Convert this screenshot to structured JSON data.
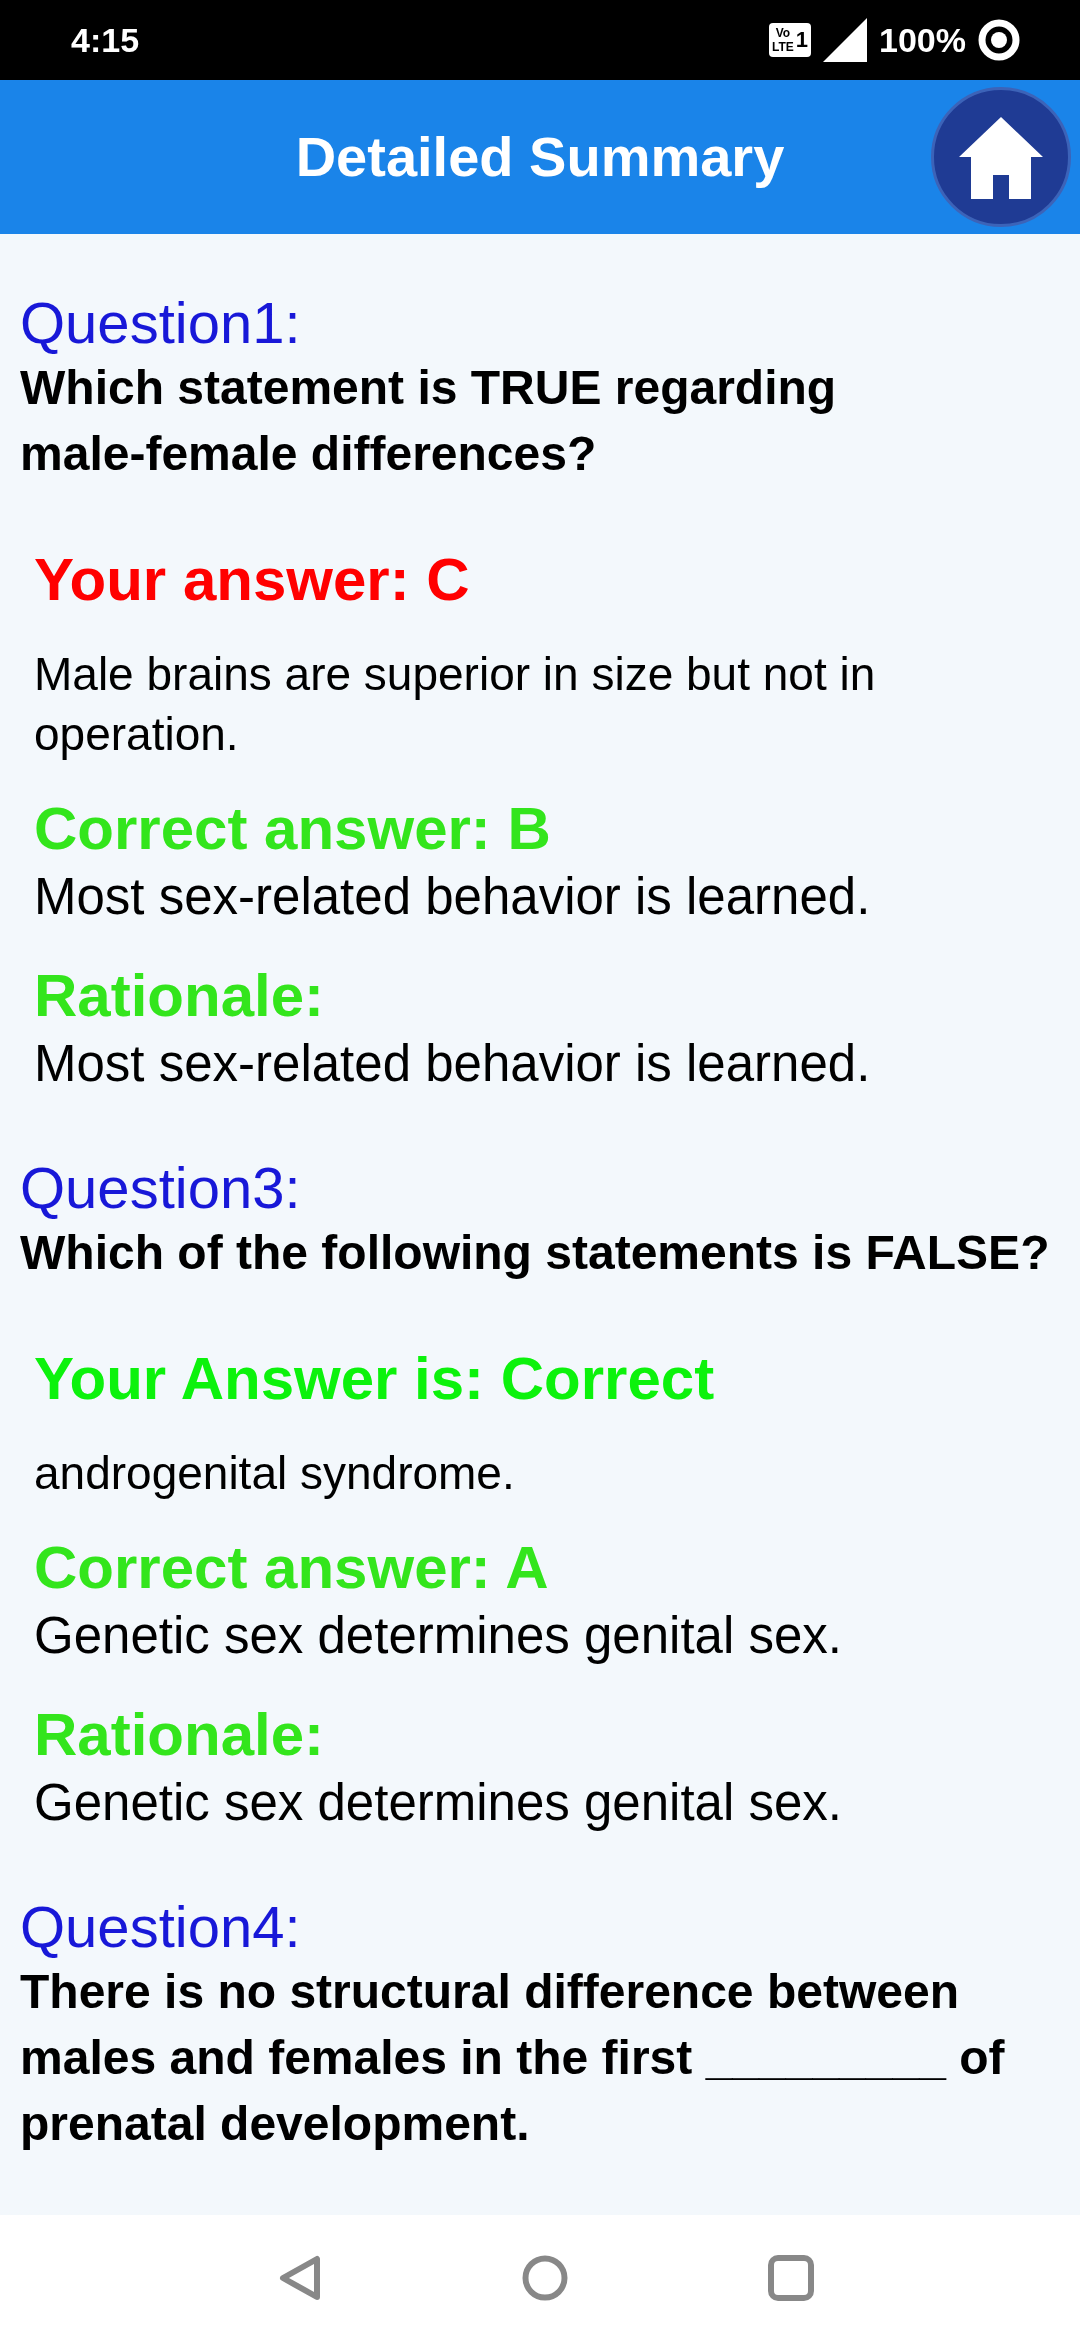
{
  "status_bar": {
    "time": "4:15",
    "volte_top": "Vo",
    "volte_bottom": "LTE",
    "sim": "1",
    "battery": "100%"
  },
  "header": {
    "title": "Detailed Summary"
  },
  "questions": [
    {
      "label": "Question1:",
      "text": "Which statement is TRUE regarding male-female differences?",
      "result": {
        "is_correct": false,
        "text": "Your answer: C"
      },
      "answer_text": "Male brains are superior in size but not in operation.",
      "correct_label": "Correct answer: B",
      "correct_text": "Most sex-related behavior is learned.",
      "rationale_label": "Rationale:",
      "rationale_text": "Most sex-related behavior is learned."
    },
    {
      "label": "Question3:",
      "text": "Which of the following statements is FALSE?",
      "result": {
        "is_correct": true,
        "text": "Your Answer is: Correct"
      },
      "answer_text": "androgenital syndrome.",
      "correct_label": "Correct answer: A",
      "correct_text": "Genetic sex determines genital sex.",
      "rationale_label": "Rationale:",
      "rationale_text": "Genetic sex determines genital sex."
    },
    {
      "label": "Question4:",
      "text": "There is no structural difference between males and females in the first _________ of prenatal development."
    }
  ]
}
